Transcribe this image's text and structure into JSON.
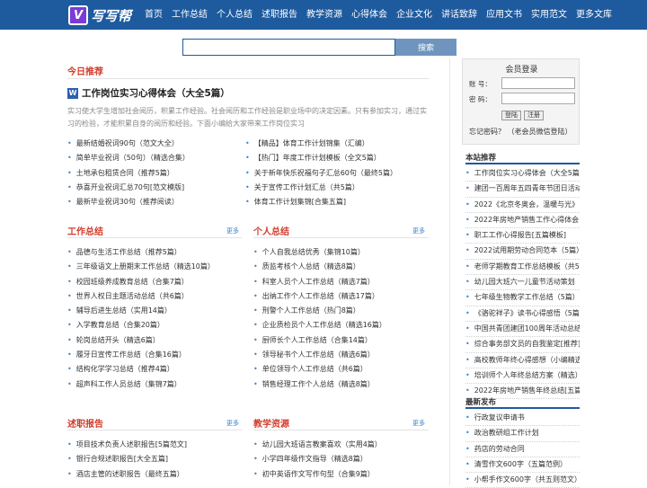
{
  "header": {
    "logo_mark": "V",
    "logo_name": "写写帮",
    "nav": [
      "首页",
      "工作总结",
      "个人总结",
      "述职报告",
      "教学资源",
      "心得体会",
      "企业文化",
      "讲话致辞",
      "应用文书",
      "实用范文",
      "更多文库"
    ]
  },
  "search": {
    "value": "",
    "placeholder": "",
    "button": "搜索"
  },
  "today": {
    "title": "今日推荐",
    "featured_icon": "W",
    "featured_title": "工作岗位实习心得体会（大全5篇）",
    "featured_desc": "实习使大学生增加社会阅历，积累工作经验。社会阅历和工作经验是职业场中的决定因素。只有参加实习，通过实习的检验，才能积累自身的阅历和经验。下面小编给大家带来工作岗位实习",
    "left": [
      "最新结婚祝词90句（范文大全）",
      "简单毕业祝词（50句）（精选合集）",
      "土地承包租赁合同（推荐5篇）",
      "恭喜开业祝词汇总70句[范文模版]",
      "最新毕业祝词30句（推荐阅读）"
    ],
    "right": [
      "【精品】体育工作计划锦集（汇编）",
      "【热门】年度工作计划模板（全文5篇）",
      "关于新年快乐祝福句子汇总60句（最终5篇）",
      "关于宣传工作计划汇总（共5篇）",
      "体育工作计划集锦[合集五篇]"
    ]
  },
  "work_summary": {
    "title": "工作总结",
    "more": "更多",
    "items": [
      "品德与生活工作总结（推荐5篇）",
      "三年级语文上册期末工作总结（精选10篇）",
      "校园班级养成教育总结（合集7篇）",
      "世界人权日主题活动总结（共6篇）",
      "辅导后进生总结（实用14篇）",
      "入学教育总结（合集20篇）",
      "轮岗总结开头（精选6篇）",
      "履牙日宣传工作总结（合集16篇）",
      "结构化学学习总结（推荐4篇）",
      "超声科工作人员总结（集锦7篇）"
    ]
  },
  "personal_summary": {
    "title": "个人总结",
    "more": "更多",
    "items": [
      "个人自我总结优秀（集锦10篇）",
      "质监考核个人总结（精选8篇）",
      "科室人员个人工作总结（精选7篇）",
      "出纳工作个人工作总结（精选17篇）",
      "刑警个人工作总结（热门8篇）",
      "企业质检员个人工作总结（精选16篇）",
      "厨师长个人工作总结（合集14篇）",
      "领导秘书个人工作总结（精选6篇）",
      "单位领导个人工作总结（共6篇）",
      "销售经理工作个人总结（精选8篇）"
    ]
  },
  "report": {
    "title": "述职报告",
    "more": "更多",
    "items": [
      "项目技术负责人述职报告[5篇范文]",
      "银行合规述职报告[大全五篇]",
      "酒店主管的述职报告（最终五篇）"
    ]
  },
  "teaching": {
    "title": "教学资源",
    "more": "更多",
    "items": [
      "幼儿园大班语言教案喜欢（实用4篇）",
      "小学四年级作文指导（精选8篇）",
      "初中英语作文写作句型（合集9篇）"
    ]
  },
  "login": {
    "title": "会员登录",
    "account_label": "账 号：",
    "password_label": "密 码：",
    "login_button": "登陆",
    "register_button": "注册",
    "forgot": "忘记密码？",
    "wechat": "（老会员微信登陆）"
  },
  "recommend": {
    "title": "本站推荐",
    "items": [
      "工作岗位实习心得体会（大全5篇）",
      "建团一百周年五四青年节团日活动",
      "2022《北京冬奥会，温暖与光》",
      "2022年房地产销售工作心得体会",
      "职工工作心得报告[五篇模板]",
      "2022试用期劳动合同范本（5篇）",
      "老师学期教育工作总结模板（共5篇）",
      "幼儿园大班六一儿童节活动策划",
      "七年级生物教学工作总结（5篇）",
      "《骆驼祥子》读书心得感悟（5篇）",
      "中国共青团建团100周年活动总结",
      "综合事务部文员的自我鉴定[推荐]",
      "高校教师年终心得感想（小编精选）",
      "培训师个人年终总结方案（精选）",
      "2022年房地产销售年终总结[五篇]"
    ]
  },
  "latest": {
    "title": "最新发布",
    "items": [
      "行政复议申请书",
      "政治教研组工作计划",
      "药店的劳动合同",
      "清雪作文600字（五篇范例）",
      "小帮手作文600字（共五则范文）"
    ]
  }
}
